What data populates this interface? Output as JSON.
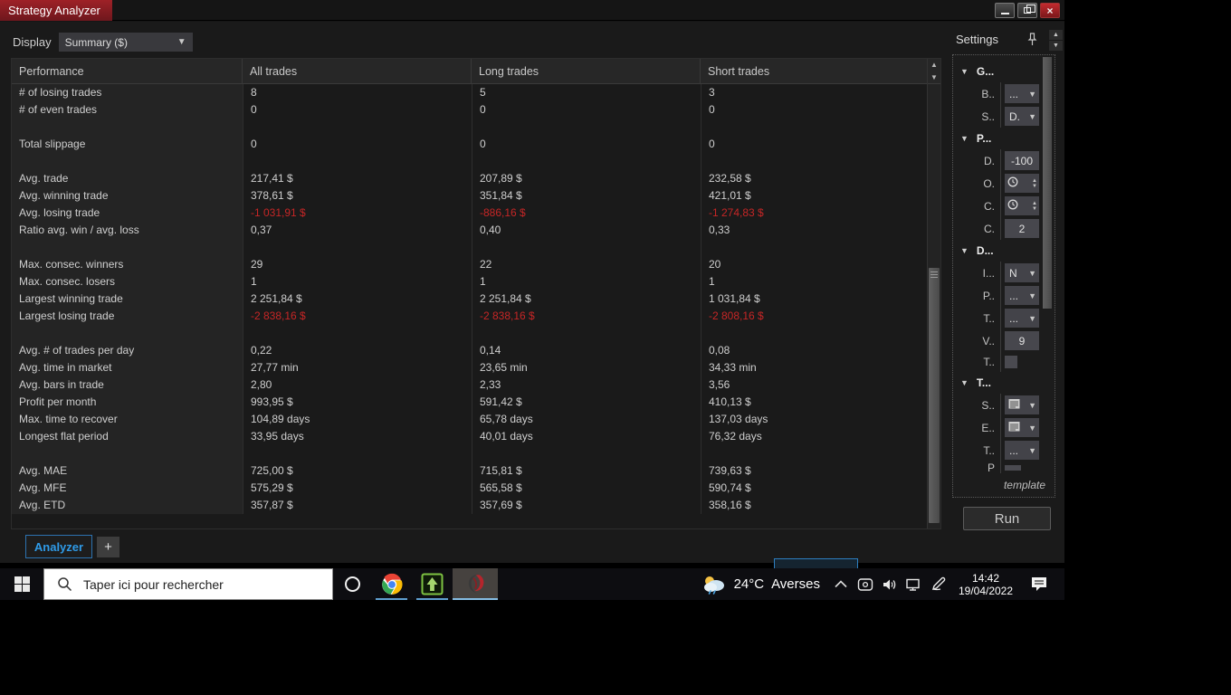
{
  "window": {
    "title": "Strategy Analyzer",
    "controls": [
      "minimize-icon",
      "restore-icon",
      "close-icon"
    ]
  },
  "toolbar": {
    "display_label": "Display",
    "display_value": "Summary ($)"
  },
  "table": {
    "columns": [
      "Performance",
      "All trades",
      "Long trades",
      "Short trades"
    ],
    "rows": [
      {
        "label": "# of losing trades",
        "all": "8",
        "long": "5",
        "short": "3"
      },
      {
        "label": "# of even trades",
        "all": "0",
        "long": "0",
        "short": "0"
      },
      {
        "label": "",
        "all": "",
        "long": "",
        "short": ""
      },
      {
        "label": "Total slippage",
        "all": "0",
        "long": "0",
        "short": "0"
      },
      {
        "label": "",
        "all": "",
        "long": "",
        "short": ""
      },
      {
        "label": "Avg. trade",
        "all": "217,41 $",
        "long": "207,89 $",
        "short": "232,58 $"
      },
      {
        "label": "Avg. winning trade",
        "all": "378,61 $",
        "long": "351,84 $",
        "short": "421,01 $"
      },
      {
        "label": "Avg. losing trade",
        "all": "-1 031,91 $",
        "long": "-886,16 $",
        "short": "-1 274,83 $",
        "neg": true
      },
      {
        "label": "Ratio avg. win / avg. loss",
        "all": "0,37",
        "long": "0,40",
        "short": "0,33"
      },
      {
        "label": "",
        "all": "",
        "long": "",
        "short": ""
      },
      {
        "label": "Max. consec. winners",
        "all": "29",
        "long": "22",
        "short": "20"
      },
      {
        "label": "Max. consec. losers",
        "all": "1",
        "long": "1",
        "short": "1"
      },
      {
        "label": "Largest winning trade",
        "all": "2 251,84 $",
        "long": "2 251,84 $",
        "short": "1 031,84 $"
      },
      {
        "label": "Largest losing trade",
        "all": "-2 838,16 $",
        "long": "-2 838,16 $",
        "short": "-2 808,16 $",
        "neg": true
      },
      {
        "label": "",
        "all": "",
        "long": "",
        "short": ""
      },
      {
        "label": "Avg. # of trades per day",
        "all": "0,22",
        "long": "0,14",
        "short": "0,08"
      },
      {
        "label": "Avg. time in market",
        "all": "27,77 min",
        "long": "23,65 min",
        "short": "34,33 min"
      },
      {
        "label": "Avg. bars in trade",
        "all": "2,80",
        "long": "2,33",
        "short": "3,56"
      },
      {
        "label": "Profit per month",
        "all": "993,95 $",
        "long": "591,42 $",
        "short": "410,13 $"
      },
      {
        "label": "Max. time to recover",
        "all": "104,89 days",
        "long": "65,78 days",
        "short": "137,03 days"
      },
      {
        "label": "Longest flat period",
        "all": "33,95 days",
        "long": "40,01 days",
        "short": "76,32 days"
      },
      {
        "label": "",
        "all": "",
        "long": "",
        "short": ""
      },
      {
        "label": "Avg. MAE",
        "all": "725,00 $",
        "long": "715,81 $",
        "short": "739,63 $"
      },
      {
        "label": "Avg. MFE",
        "all": "575,29 $",
        "long": "565,58 $",
        "short": "590,74 $"
      },
      {
        "label": "Avg. ETD",
        "all": "357,87 $",
        "long": "357,69 $",
        "short": "358,16 $"
      }
    ]
  },
  "settings": {
    "title": "Settings",
    "groups": [
      {
        "label": "G...",
        "items": [
          {
            "label": "B..",
            "control": "dropdown",
            "value": "..."
          },
          {
            "label": "S..",
            "control": "dropdown",
            "value": "D."
          }
        ]
      },
      {
        "label": "P...",
        "items": [
          {
            "label": "D.",
            "control": "input",
            "value": "-100"
          },
          {
            "label": "O.",
            "control": "time",
            "value": ""
          },
          {
            "label": "C.",
            "control": "time",
            "value": ""
          },
          {
            "label": "C.",
            "control": "input",
            "value": "2"
          }
        ]
      },
      {
        "label": "D...",
        "items": [
          {
            "label": "I...",
            "control": "dropdown",
            "value": "N"
          },
          {
            "label": "P..",
            "control": "dropdown",
            "value": "..."
          },
          {
            "label": "T..",
            "control": "dropdown",
            "value": "..."
          },
          {
            "label": "V..",
            "control": "input",
            "value": "9"
          },
          {
            "label": "T..",
            "control": "checkbox",
            "value": ""
          }
        ]
      },
      {
        "label": "T...",
        "items": [
          {
            "label": "S..",
            "control": "date",
            "value": ""
          },
          {
            "label": "E..",
            "control": "date",
            "value": ""
          },
          {
            "label": "T..",
            "control": "dropdown",
            "value": "..."
          },
          {
            "label": "P",
            "control": "partial",
            "value": ""
          }
        ]
      }
    ],
    "template_label": "template",
    "run_label": "Run"
  },
  "tabs": {
    "analyzer": "Analyzer",
    "add": "+"
  },
  "taskbar": {
    "search_placeholder": "Taper ici pour rechercher",
    "weather": {
      "temp": "24°C",
      "desc": "Averses"
    },
    "clock": {
      "time": "14:42",
      "date": "19/04/2022"
    },
    "tray_icons": [
      "weather-icon",
      "chevron-up-icon",
      "device-icon",
      "speaker-icon",
      "network-icon",
      "pen-icon",
      "action-center-icon"
    ],
    "app_icons": [
      "start-icon",
      "search-icon",
      "cortana-icon",
      "chrome-icon",
      "ninjatrader-green-icon",
      "ninjatrader-red-icon"
    ]
  },
  "colors": {
    "title_red": "#8e1f25",
    "accent_blue": "#2f9be8",
    "negative_red": "#c62626",
    "taskbar_underline": "#5f9fd0"
  }
}
